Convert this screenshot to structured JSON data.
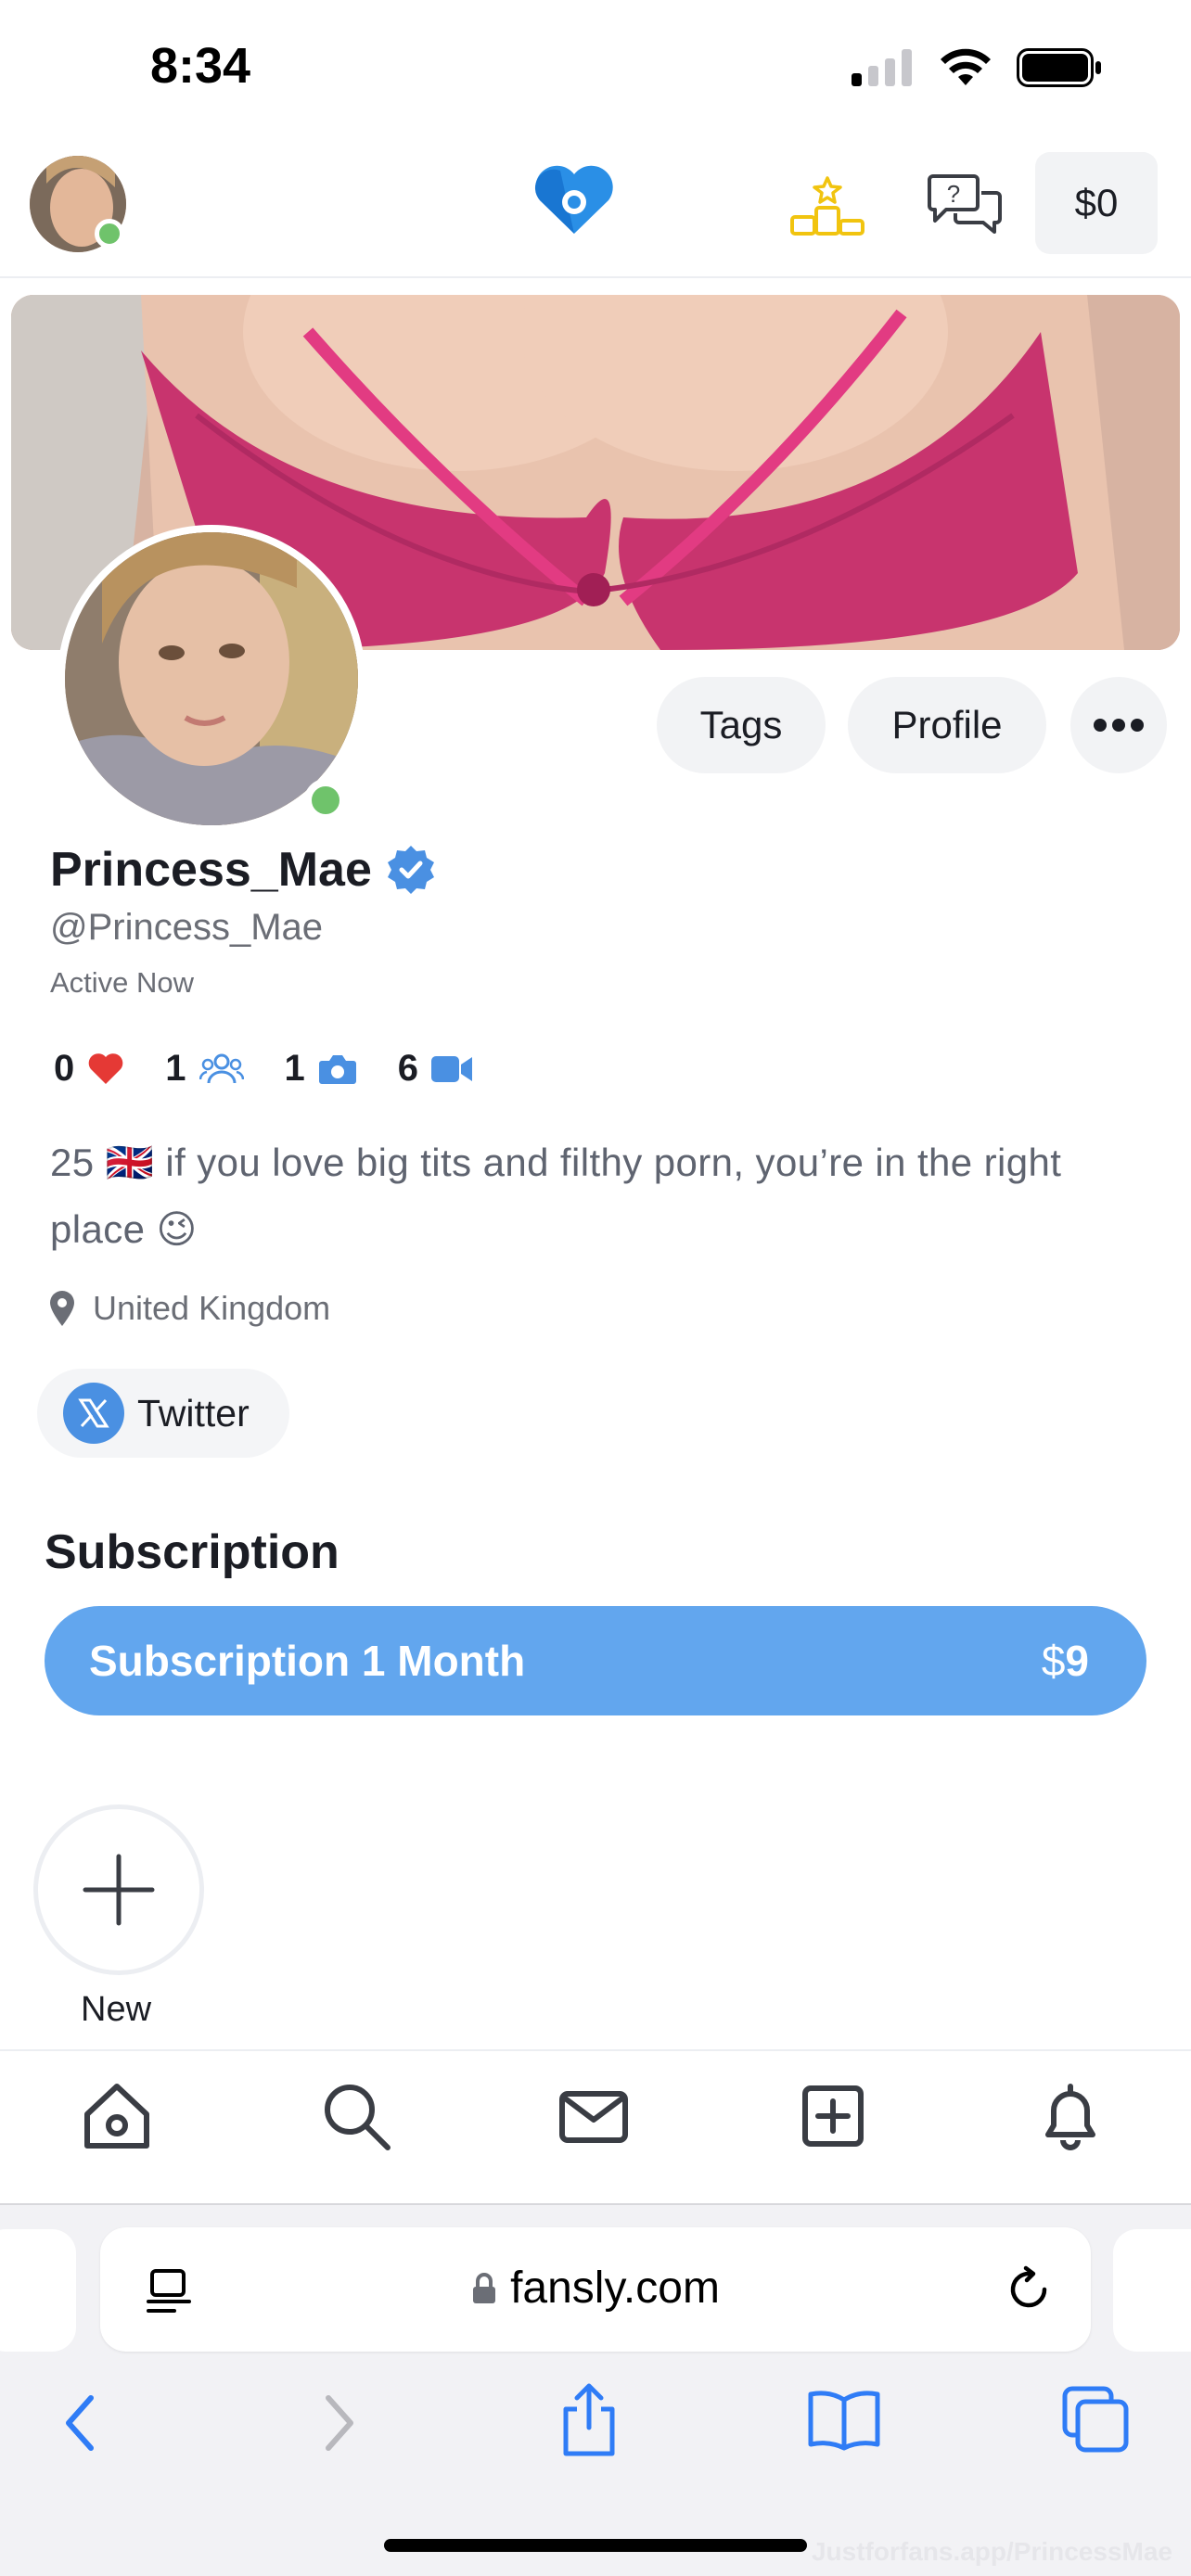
{
  "status_bar": {
    "time": "8:34"
  },
  "top_nav": {
    "wallet": "$0"
  },
  "profile": {
    "display_name": "Princess_Mae",
    "handle": "@Princess_Mae",
    "status": "Active Now",
    "buttons": {
      "tags": "Tags",
      "profile": "Profile"
    },
    "stats": {
      "likes": "0",
      "followers": "1",
      "photos": "1",
      "videos": "6"
    },
    "bio": "25 🇬🇧 if you love big tits and filthy porn, you’re in the right place 😉",
    "location": "United Kingdom",
    "social": {
      "twitter_label": "Twitter"
    }
  },
  "subscription": {
    "heading": "Subscription",
    "plan_label": "Subscription 1 Month",
    "currency": "$",
    "price": "9"
  },
  "stories": {
    "new_label": "New"
  },
  "browser": {
    "url": "fansly.com"
  },
  "watermark": "Justforfans.app/PrincessMae",
  "colors": {
    "accent": "#62a6ee",
    "online": "#6fc36b",
    "heart": "#e53935",
    "gold": "#f1c40f",
    "stat_blue": "#4a90e2"
  },
  "icons": [
    "signal-icon",
    "wifi-icon",
    "battery-icon",
    "fansly-logo",
    "leaderboard-icon",
    "chat-icon",
    "verified-icon",
    "heart-icon",
    "followers-icon",
    "camera-icon",
    "video-icon",
    "location-pin-icon",
    "x-logo-icon",
    "plus-icon",
    "home-icon",
    "search-icon",
    "mail-icon",
    "add-post-icon",
    "bell-icon",
    "reader-icon",
    "lock-icon",
    "reload-icon",
    "back-icon",
    "forward-icon",
    "share-icon",
    "bookmarks-icon",
    "tabs-icon"
  ]
}
